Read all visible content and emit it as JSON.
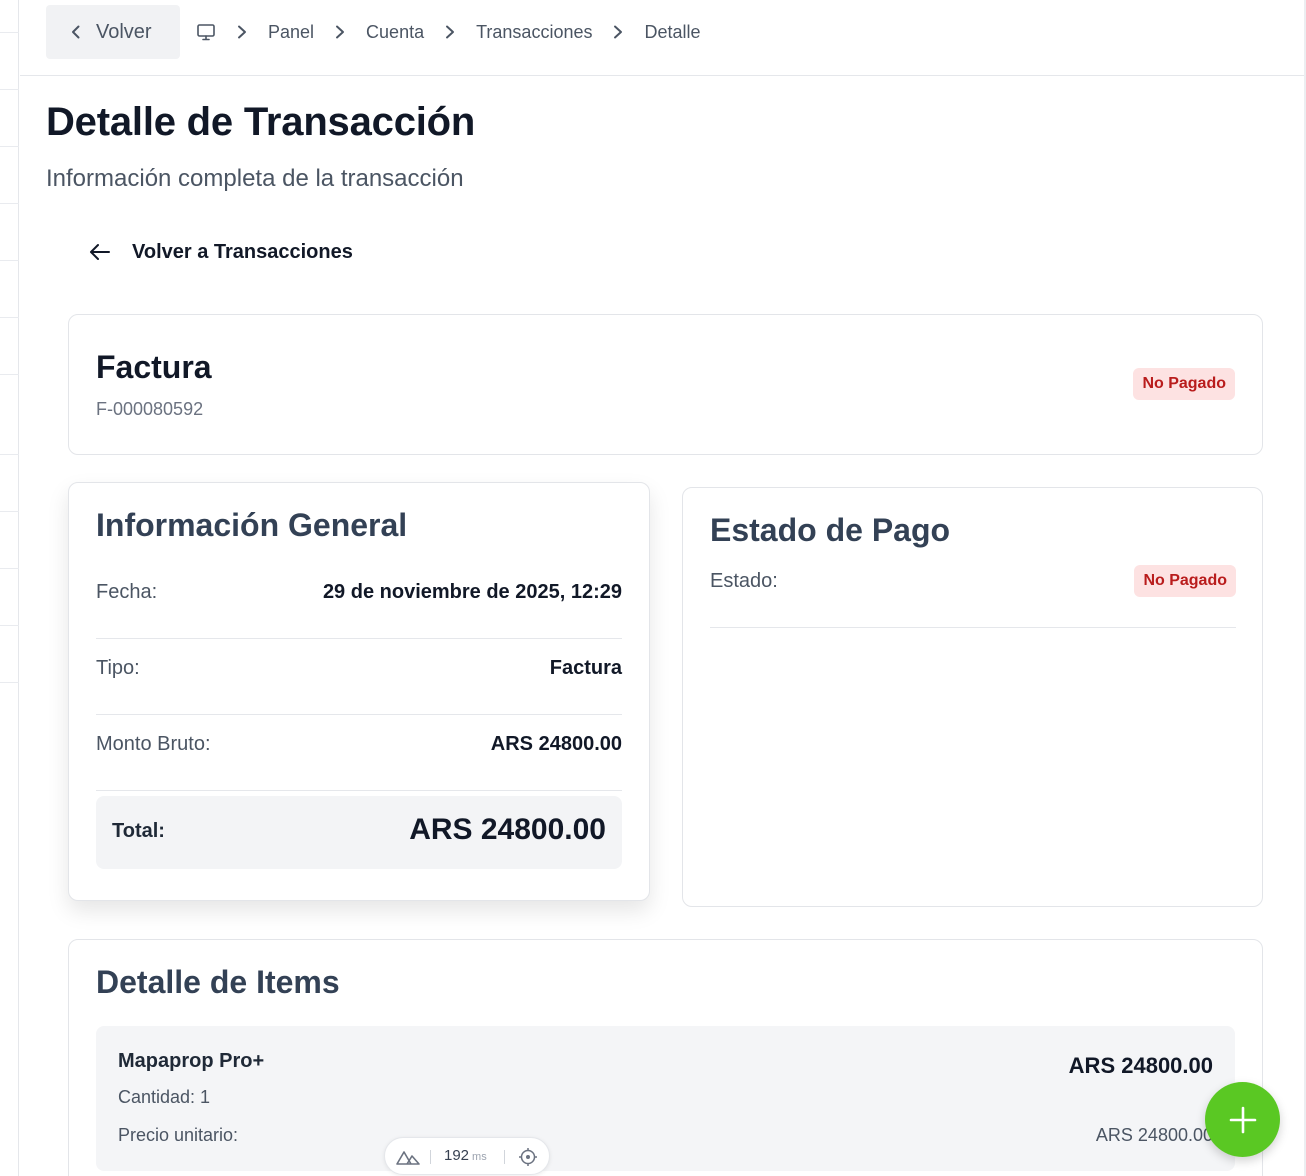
{
  "nav": {
    "back_label": "Volver",
    "breadcrumbs": [
      "Panel",
      "Cuenta",
      "Transacciones",
      "Detalle"
    ]
  },
  "page": {
    "title": "Detalle de Transacción",
    "subtitle": "Información completa de la transacción",
    "back_link": "Volver a Transacciones"
  },
  "header_card": {
    "type": "Factura",
    "number": "F-000080592",
    "status": "No Pagado"
  },
  "general": {
    "title": "Información General",
    "rows": [
      {
        "label": "Fecha:",
        "value": "29 de noviembre de 2025, 12:29"
      },
      {
        "label": "Tipo:",
        "value": "Factura"
      },
      {
        "label": "Monto Bruto:",
        "value": "ARS 24800.00"
      }
    ],
    "total_label": "Total:",
    "total_value": "ARS 24800.00"
  },
  "payment": {
    "title": "Estado de Pago",
    "status_label": "Estado:",
    "status_value": "No Pagado"
  },
  "items": {
    "title": "Detalle de Items",
    "list": [
      {
        "name": "Mapaprop Pro+",
        "quantity": "Cantidad: 1",
        "unit_price_label": "Precio unitario:",
        "unit_price": "ARS 24800.00",
        "amount": "ARS 24800.00"
      }
    ]
  },
  "devtools": {
    "timing_value": "192",
    "timing_unit": "ms"
  },
  "colors": {
    "accent_fab": "#5ac823",
    "badge_bg": "#fde2e2",
    "badge_text": "#b91c1c"
  },
  "icons": [
    "chevron-left-icon",
    "monitor-icon",
    "chevron-right-icon",
    "arrow-left-icon",
    "plus-icon",
    "nuxt-logo-icon",
    "crosshair-icon"
  ]
}
